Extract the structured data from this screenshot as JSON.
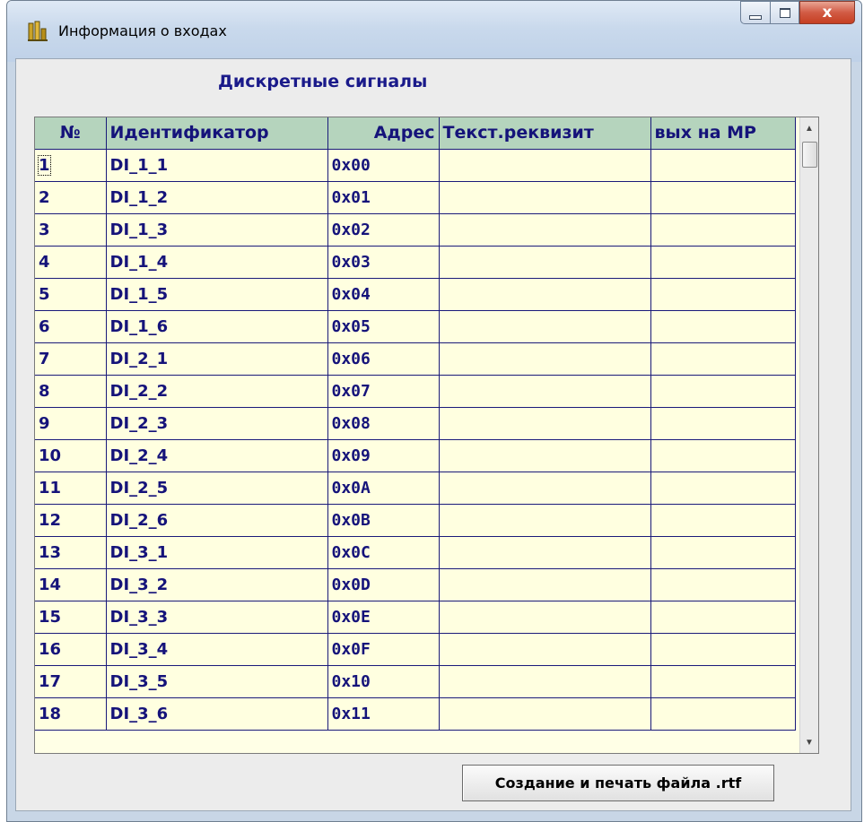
{
  "window": {
    "title": "Информация о входах",
    "close_symbol": "x",
    "accent_close": "#c63f22",
    "icon": "app-icon"
  },
  "heading": "Дискретные сигналы",
  "table": {
    "columns": [
      "№",
      "Идентификатор",
      "Адрес",
      "Текст.реквизит",
      "вых на МР"
    ],
    "rows": [
      [
        "1",
        "DI_1_1",
        "0x00",
        "",
        ""
      ],
      [
        "2",
        "DI_1_2",
        "0x01",
        "",
        ""
      ],
      [
        "3",
        "DI_1_3",
        "0x02",
        "",
        ""
      ],
      [
        "4",
        "DI_1_4",
        "0x03",
        "",
        ""
      ],
      [
        "5",
        "DI_1_5",
        "0x04",
        "",
        ""
      ],
      [
        "6",
        "DI_1_6",
        "0x05",
        "",
        ""
      ],
      [
        "7",
        "DI_2_1",
        "0x06",
        "",
        ""
      ],
      [
        "8",
        "DI_2_2",
        "0x07",
        "",
        ""
      ],
      [
        "9",
        "DI_2_3",
        "0x08",
        "",
        ""
      ],
      [
        "10",
        "DI_2_4",
        "0x09",
        "",
        ""
      ],
      [
        "11",
        "DI_2_5",
        "0x0A",
        "",
        ""
      ],
      [
        "12",
        "DI_2_6",
        "0x0B",
        "",
        ""
      ],
      [
        "13",
        "DI_3_1",
        "0x0C",
        "",
        ""
      ],
      [
        "14",
        "DI_3_2",
        "0x0D",
        "",
        ""
      ],
      [
        "15",
        "DI_3_3",
        "0x0E",
        "",
        ""
      ],
      [
        "16",
        "DI_3_4",
        "0x0F",
        "",
        ""
      ],
      [
        "17",
        "DI_3_5",
        "0x10",
        "",
        ""
      ],
      [
        "18",
        "DI_3_6",
        "0x11",
        "",
        ""
      ]
    ],
    "header_bg": "#b5d4bd",
    "cell_bg": "#ffffe0",
    "text_color": "#15137a"
  },
  "buttons": {
    "rtf": "Создание и печать файла .rtf"
  }
}
